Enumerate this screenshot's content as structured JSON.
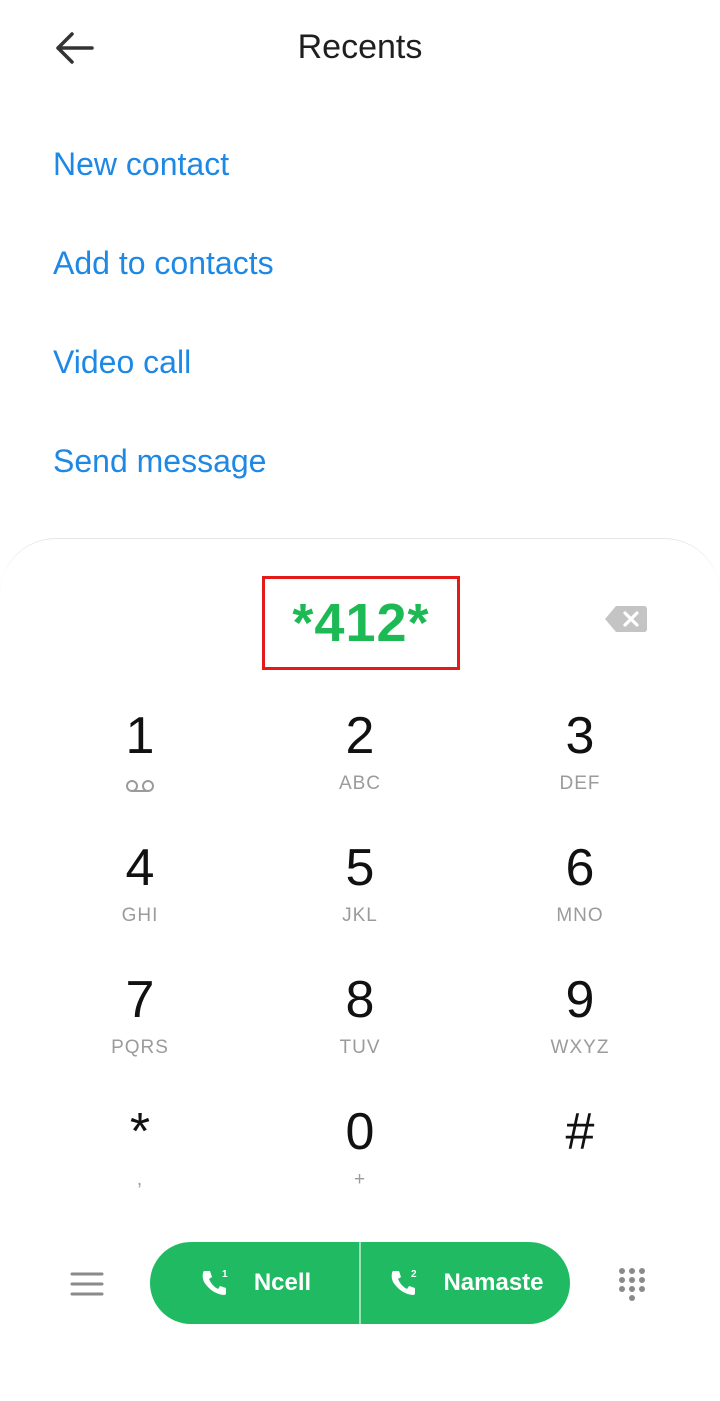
{
  "header": {
    "title": "Recents",
    "back_icon": "arrow-left-icon"
  },
  "menu": {
    "items": [
      {
        "label": "New contact"
      },
      {
        "label": "Add to contacts"
      },
      {
        "label": "Video call"
      },
      {
        "label": "Send message"
      }
    ]
  },
  "dialer": {
    "number": "*412*",
    "delete_icon": "backspace-icon",
    "keys": [
      {
        "digit": "1",
        "letters": ""
      },
      {
        "digit": "2",
        "letters": "ABC"
      },
      {
        "digit": "3",
        "letters": "DEF"
      },
      {
        "digit": "4",
        "letters": "GHI"
      },
      {
        "digit": "5",
        "letters": "JKL"
      },
      {
        "digit": "6",
        "letters": "MNO"
      },
      {
        "digit": "7",
        "letters": "PQRS"
      },
      {
        "digit": "8",
        "letters": "TUV"
      },
      {
        "digit": "9",
        "letters": "WXYZ"
      },
      {
        "digit": "*",
        "letters": ","
      },
      {
        "digit": "0",
        "letters": "+"
      },
      {
        "digit": "#",
        "letters": ""
      }
    ],
    "voicemail_icon": "voicemail-icon"
  },
  "bottom_bar": {
    "menu_icon": "hamburger-menu-icon",
    "sim1": {
      "label": "Ncell",
      "badge": "1"
    },
    "sim2": {
      "label": "Namaste",
      "badge": "2"
    },
    "keypad_icon": "dialpad-icon",
    "accent_color": "#1fba62"
  },
  "colors": {
    "link": "#1e88e5",
    "number": "#1db954",
    "highlight_border": "#e31b1b"
  }
}
